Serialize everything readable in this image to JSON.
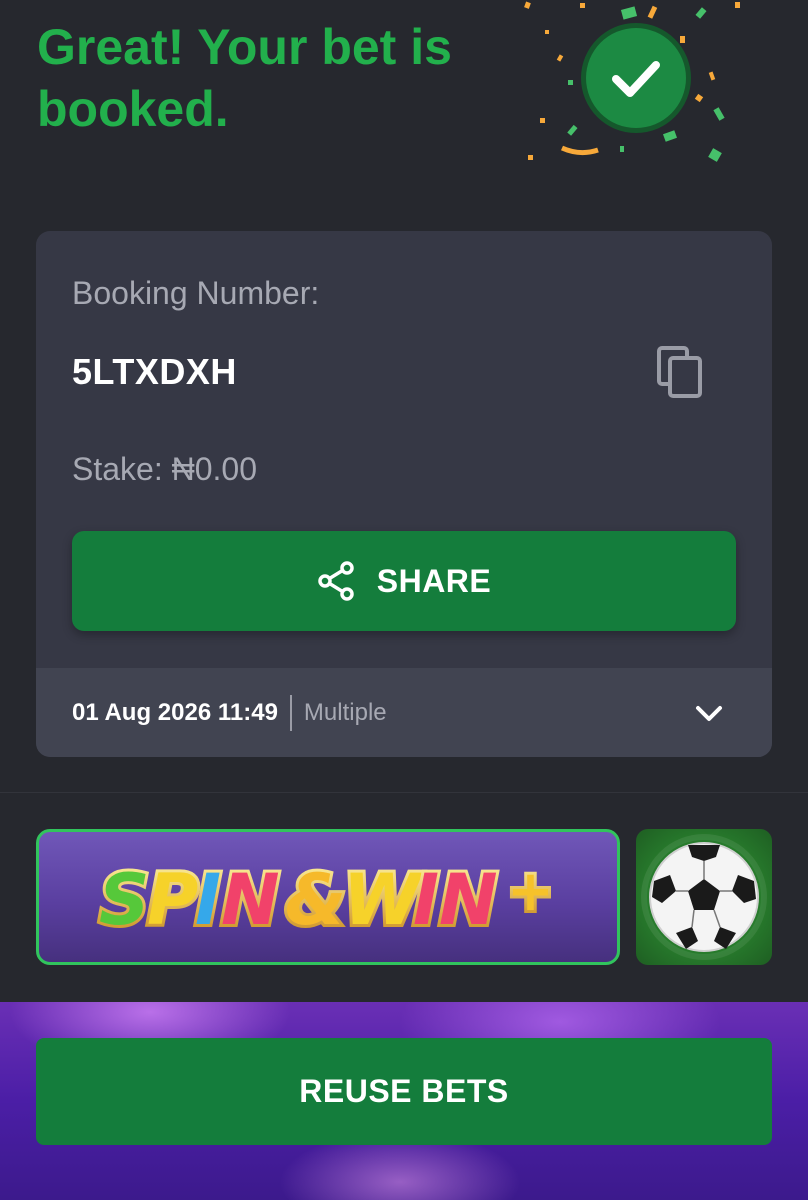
{
  "header": {
    "headline": "Great! Your bet is booked.",
    "success_icon": "check-circle-icon",
    "accent_color": "#22b04c"
  },
  "booking": {
    "number_label": "Booking Number:",
    "number": "5LTXDXH",
    "copy_icon": "copy-icon",
    "stake_text": "Stake: ₦0.00",
    "share_label": "SHARE",
    "share_icon": "share-icon",
    "date_time": "01 Aug 2026 11:49",
    "bet_type": "Multiple",
    "expand_icon": "chevron-down-icon",
    "button_color": "#147d3c"
  },
  "promos": {
    "spin_win_logo": "SPIN & WIN +",
    "ball_tile_icon": "soccer-ball-icon"
  },
  "footer": {
    "reuse_label": "REUSE BETS"
  }
}
